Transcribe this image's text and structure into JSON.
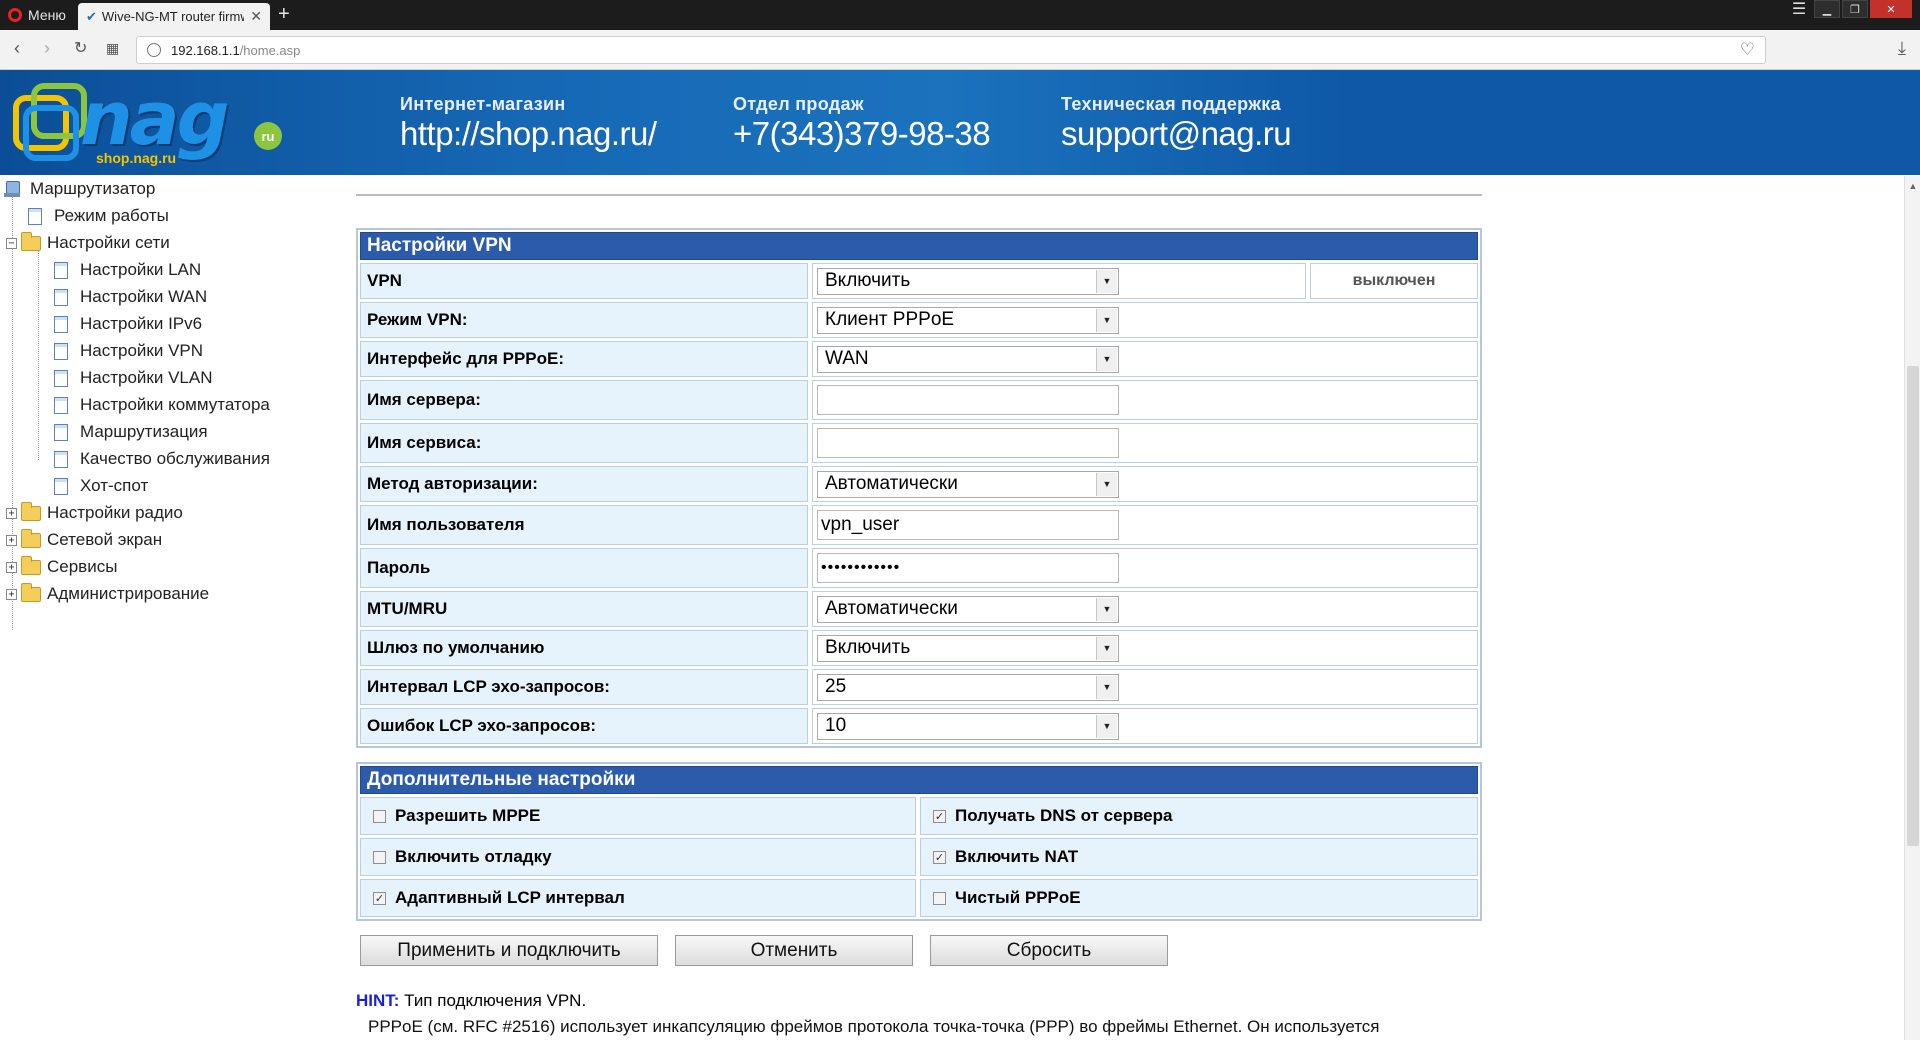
{
  "browser": {
    "menu_label": "Меню",
    "tab_title": "Wive-NG-MT router firmw",
    "url_host": "192.168.1.1",
    "url_path": "/home.asp"
  },
  "banner": {
    "logo_text": "nag",
    "logo_sub": "shop.nag.ru",
    "logo_ru": "ru",
    "shop_label": "Интернет-магазин",
    "shop_value": "http://shop.nag.ru/",
    "sales_label": "Отдел продаж",
    "sales_value": "+7(343)379-98-38",
    "support_label": "Техническая поддержка",
    "support_value": "support@nag.ru"
  },
  "tree": {
    "root": "Маршрутизатор",
    "items": [
      "Режим работы",
      "Настройки сети",
      "Настройки LAN",
      "Настройки WAN",
      "Настройки IPv6",
      "Настройки VPN",
      "Настройки VLAN",
      "Настройки коммутатора",
      "Маршрутизация",
      "Качество обслуживания",
      "Хот-спот",
      "Настройки радио",
      "Сетевой экран",
      "Сервисы",
      "Администрирование"
    ]
  },
  "vpn": {
    "title": "Настройки VPN",
    "status": "выключен",
    "rows": [
      {
        "label": "VPN",
        "value": "Включить"
      },
      {
        "label": "Режим VPN:",
        "value": "Клиент PPPoE"
      },
      {
        "label": "Интерфейс для PPPoE:",
        "value": "WAN"
      },
      {
        "label": "Имя сервера:",
        "value": ""
      },
      {
        "label": "Имя сервиса:",
        "value": ""
      },
      {
        "label": "Метод авторизации:",
        "value": "Автоматически"
      },
      {
        "label": "Имя пользователя",
        "value": "vpn_user"
      },
      {
        "label": "Пароль",
        "value": "••••••••••••"
      },
      {
        "label": "MTU/MRU",
        "value": "Автоматически"
      },
      {
        "label": "Шлюз по умолчанию",
        "value": "Включить"
      },
      {
        "label": "Интервал LCP эхо-запросов:",
        "value": "25"
      },
      {
        "label": "Ошибок LCP эхо-запросов:",
        "value": "10"
      }
    ]
  },
  "extra": {
    "title": "Дополнительные настройки",
    "options": [
      {
        "label": "Разрешить MPPE",
        "checked": false
      },
      {
        "label": "Получать DNS от сервера",
        "checked": true
      },
      {
        "label": "Включить отладку",
        "checked": false
      },
      {
        "label": "Включить NAT",
        "checked": true
      },
      {
        "label": "Адаптивный LCP интервал",
        "checked": true
      },
      {
        "label": "Чистый PPPoE",
        "checked": false
      }
    ]
  },
  "buttons": {
    "apply": "Применить и подключить",
    "cancel": "Отменить",
    "reset": "Сбросить"
  },
  "hint": {
    "label": "HINT:",
    "text": " Тип подключения VPN.",
    "text2": "PPPoE (см. RFC #2516) использует инкапсуляцию фреймов протокола точка-точка (PPP) во фреймы Ethernet. Он используется"
  },
  "colors": {
    "section_header": "#2d5bab",
    "label_cell": "#e6f3fc",
    "banner": "#0e58a7"
  }
}
